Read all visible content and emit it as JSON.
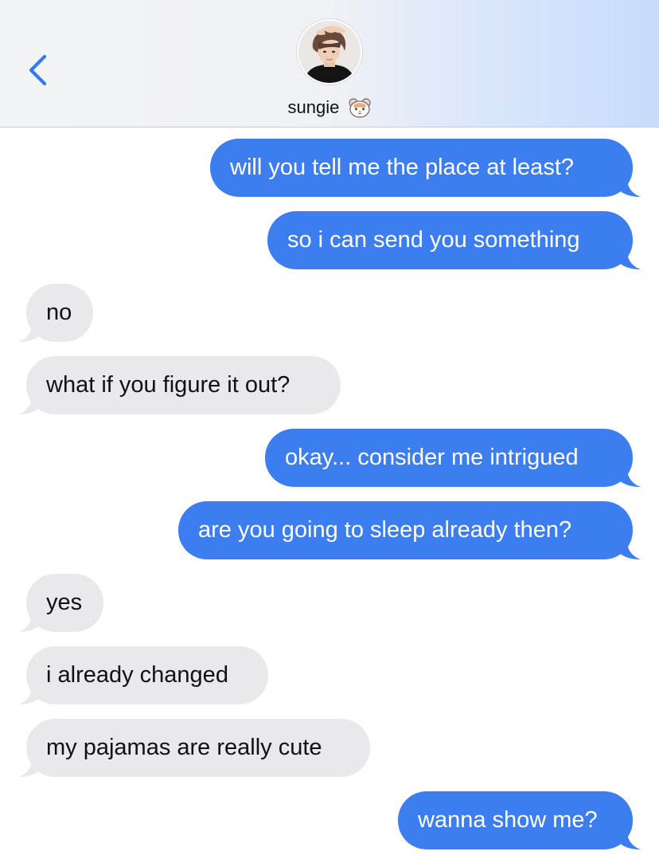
{
  "header": {
    "back_icon": "chevron-left-icon",
    "contact_name": "sungie",
    "contact_emoji": "hamster-face-icon",
    "accent_color": "#3c7ef0"
  },
  "messages": [
    {
      "direction": "sent",
      "text": "will you tell me the place at least?"
    },
    {
      "direction": "sent",
      "text": "so i can send you something"
    },
    {
      "direction": "received",
      "text": "no"
    },
    {
      "direction": "received",
      "text": "what if you figure it out?"
    },
    {
      "direction": "sent",
      "text": "okay... consider me intrigued"
    },
    {
      "direction": "sent",
      "text": "are you going to sleep already then?"
    },
    {
      "direction": "received",
      "text": "yes"
    },
    {
      "direction": "received",
      "text": "i already changed"
    },
    {
      "direction": "received",
      "text": "my pajamas are really cute"
    },
    {
      "direction": "sent",
      "text": "wanna show me?"
    }
  ],
  "colors": {
    "sent_bubble": "#3c7ef0",
    "received_bubble": "#e9e9eb"
  }
}
